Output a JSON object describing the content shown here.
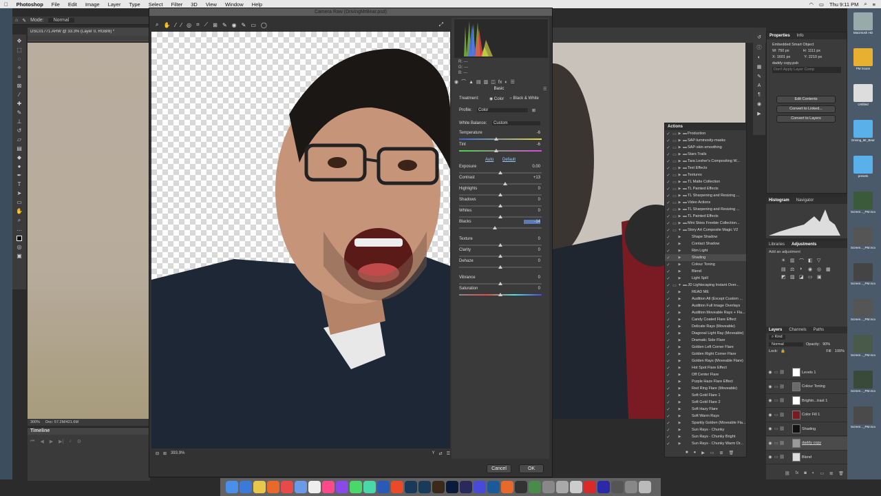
{
  "menubar": {
    "app": "Photoshop",
    "items": [
      "File",
      "Edit",
      "Image",
      "Layer",
      "Type",
      "Select",
      "Filter",
      "3D",
      "View",
      "Window",
      "Help"
    ],
    "clock": "Thu 9:11 PM"
  },
  "ps": {
    "mode_label": "Mode:",
    "mode_value": "Normal",
    "doc_tab": "DSC01771.ARW @ 33.3% (Layer 0, RGB/8) *",
    "doc_tab2": "Driving",
    "zoom": "300%",
    "doc_info": "Doc: 57.2M/421.6M",
    "timeline": "Timeline"
  },
  "camera_raw": {
    "title": "Camera Raw (DrivingMrBear.psd)",
    "rgb": {
      "r": "R:  ---",
      "g": "G:  ---",
      "b": "B:  ---"
    },
    "panel_title": "Basic",
    "treatment_label": "Treatment:",
    "treatment_color": "Color",
    "treatment_bw": "Black & White",
    "profile_label": "Profile:",
    "profile_value": "Color",
    "wb_label": "White Balance:",
    "wb_value": "Custom",
    "auto": "Auto",
    "default": "Default",
    "sliders": [
      {
        "label": "Temperature",
        "value": "-6",
        "pos": 0.45
      },
      {
        "label": "Tint",
        "value": "-6",
        "pos": 0.45
      },
      {
        "label": "Exposure",
        "value": "0.00",
        "pos": 0.5
      },
      {
        "label": "Contrast",
        "value": "+13",
        "pos": 0.56
      },
      {
        "label": "Highlights",
        "value": "0",
        "pos": 0.5
      },
      {
        "label": "Shadows",
        "value": "0",
        "pos": 0.5
      },
      {
        "label": "Whites",
        "value": "0",
        "pos": 0.5
      },
      {
        "label": "Blacks",
        "value": "-14",
        "pos": 0.43
      },
      {
        "label": "Texture",
        "value": "0",
        "pos": 0.5
      },
      {
        "label": "Clarity",
        "value": "0",
        "pos": 0.5
      },
      {
        "label": "Dehaze",
        "value": "0",
        "pos": 0.5
      },
      {
        "label": "Vibrance",
        "value": "0",
        "pos": 0.5
      },
      {
        "label": "Saturation",
        "value": "0",
        "pos": 0.5
      }
    ],
    "zoom": "393.9%",
    "cancel": "Cancel",
    "ok": "OK"
  },
  "actions": {
    "title": "Actions",
    "items": [
      {
        "name": "Production",
        "folder": true
      },
      {
        "name": "SAP-luminosity-masks",
        "folder": true
      },
      {
        "name": "SAP-skin-smoothing",
        "folder": true
      },
      {
        "name": "Stars Trails",
        "folder": true
      },
      {
        "name": "Tara Lesher's Compositing W...",
        "folder": true
      },
      {
        "name": "Text Effects",
        "folder": true
      },
      {
        "name": "Textures",
        "folder": true
      },
      {
        "name": "TL Matte Collection",
        "folder": true
      },
      {
        "name": "TL Painted Effects",
        "folder": true
      },
      {
        "name": "TL Sharpening and Resizing ...",
        "folder": true
      },
      {
        "name": "Video Actions",
        "folder": true
      },
      {
        "name": "TL Sharpening and Resizing ...",
        "folder": true
      },
      {
        "name": "TL Painted Effects",
        "folder": true
      },
      {
        "name": "Mini Skies Freebie Collection...",
        "folder": true
      },
      {
        "name": "Story Art Composite Magic V2",
        "folder": true,
        "open": true
      },
      {
        "name": "Shape Shadow",
        "folder": false
      },
      {
        "name": "Contact Shadow",
        "folder": false
      },
      {
        "name": "Rim Light",
        "folder": false
      },
      {
        "name": "Shading",
        "folder": false,
        "sel": true
      },
      {
        "name": "Colour Toning",
        "folder": false
      },
      {
        "name": "Blend",
        "folder": false
      },
      {
        "name": "Light Spill",
        "folder": false
      },
      {
        "name": "JD Lightscaping Instant Over...",
        "folder": true,
        "open": true
      },
      {
        "name": "READ ME",
        "folder": false
      },
      {
        "name": "Audition All (Except Custom ...",
        "folder": false
      },
      {
        "name": "Audition Full Image Overlays",
        "folder": false
      },
      {
        "name": "Audition Moveable Rays + Fla...",
        "folder": false
      },
      {
        "name": "Candy Coated Flare Effect",
        "folder": false
      },
      {
        "name": "Delicate Rays (Moveable)",
        "folder": false
      },
      {
        "name": "Diagonal Light Ray (Moveable)",
        "folder": false
      },
      {
        "name": "Dramatic Side Flare",
        "folder": false
      },
      {
        "name": "Golden Left Corner Flare",
        "folder": false
      },
      {
        "name": "Golden Right Corner Flare",
        "folder": false
      },
      {
        "name": "Golden Rays (Moveable Flare)",
        "folder": false
      },
      {
        "name": "Hot Spot Flare Effect",
        "folder": false
      },
      {
        "name": "Off Center Flare",
        "folder": false
      },
      {
        "name": "Purple Haze Flare Effect",
        "folder": false
      },
      {
        "name": "Red Ring Flare (Moveable)",
        "folder": false
      },
      {
        "name": "Soft Gold Flare 1",
        "folder": false
      },
      {
        "name": "Soft Gold Flare 2",
        "folder": false
      },
      {
        "name": "Soft Hazy Flare",
        "folder": false
      },
      {
        "name": "Soft Warm Rays",
        "folder": false
      },
      {
        "name": "Sparkly Golden (Moveable Fla...",
        "folder": false
      },
      {
        "name": "Sun Rays - Chunky",
        "folder": false
      },
      {
        "name": "Sun Rays - Chunky Bright",
        "folder": false
      },
      {
        "name": "Sun Rays - Chunky Warm Dr...",
        "folder": false
      }
    ]
  },
  "properties": {
    "tabs": [
      "Properties",
      "Info"
    ],
    "kind": "Embedded Smart Object",
    "w": "W: 750 px",
    "h": "H: 1111 px",
    "x": "X: 1601 px",
    "y": "Y: 2210 px",
    "file": "daddy copy.psb",
    "apply_comp": "Don't Apply Layer Comp",
    "b1": "Edit Contents",
    "b2": "Convert to Linked...",
    "b3": "Convert to Layers"
  },
  "histogram": {
    "tabs": [
      "Histogram",
      "Navigator"
    ]
  },
  "adjustments": {
    "tabs": [
      "Libraries",
      "Adjustments"
    ],
    "hint": "Add an adjustment"
  },
  "layers": {
    "tabs": [
      "Layers",
      "Channels",
      "Paths"
    ],
    "kind": "Kind",
    "blend": "Normal",
    "opacity_label": "Opacity:",
    "opacity": "90%",
    "lock_label": "Lock:",
    "fill_label": "Fill:",
    "fill": "100%",
    "items": [
      {
        "name": "Levels 1",
        "color": "#fff"
      },
      {
        "name": "Colour Toning",
        "color": "#6a6a6a"
      },
      {
        "name": "Brightn...trast 1",
        "color": "#fff"
      },
      {
        "name": "Color Fill 1",
        "color": "#7a1a22"
      },
      {
        "name": "Shading",
        "color": "#111"
      },
      {
        "name": "daddy copy",
        "color": "#9a9a9a"
      },
      {
        "name": "Blend",
        "color": "#ddd"
      }
    ]
  },
  "desktop": [
    {
      "label": "Macintosh HD",
      "color": "#9aa"
    },
    {
      "label": "PM Scans",
      "color": "#e8b030"
    },
    {
      "label": "Untitled",
      "color": "#ddd"
    },
    {
      "label": "Driving_Mr_Bear",
      "color": "#5ab0e8"
    },
    {
      "label": "presets",
      "color": "#5ab0e8"
    },
    {
      "label": "Screen..._PM.mov",
      "color": "#3a5a3a"
    },
    {
      "label": "Screen..._PM.mov",
      "color": "#555"
    },
    {
      "label": "Screen..._PM.mov",
      "color": "#444"
    },
    {
      "label": "Screen..._PM.mov",
      "color": "#555"
    },
    {
      "label": "Screen..._PM.mov",
      "color": "#4a5a4a"
    },
    {
      "label": "Screen..._PM.mov",
      "color": "#3a4a3a"
    },
    {
      "label": "Screen..._PM.mov",
      "color": "#4a4a4a"
    }
  ]
}
